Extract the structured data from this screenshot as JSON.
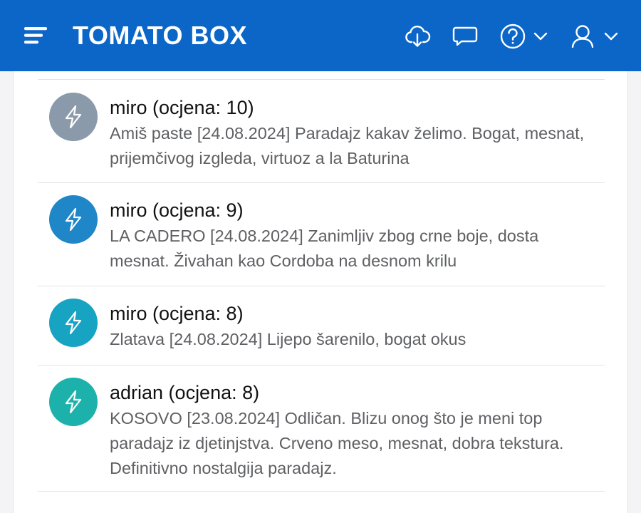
{
  "header": {
    "title": "TOMATO BOX",
    "background": "#0b66c8",
    "icons": [
      "menu-icon",
      "cloud-download-icon",
      "chat-bubble-icon",
      "help-icon",
      "chevron-down-icon",
      "user-icon",
      "chevron-down-icon"
    ]
  },
  "reviews": [
    {
      "title": "miro (ocjena: 10)",
      "body": "Amiš paste [24.08.2024] Paradajz kakav želimo. Bogat, mesnat, prijemčivog izgleda, virtuoz a la Baturina",
      "avatar_color": "#8a9aab",
      "icon": "lightning-icon"
    },
    {
      "title": "miro (ocjena: 9)",
      "body": "LA CADERO [24.08.2024] Zanimljiv zbog crne boje, dosta mesnat. Živahan kao Cordoba na desnom krilu",
      "avatar_color": "#1f86c8",
      "icon": "lightning-icon"
    },
    {
      "title": "miro (ocjena: 8)",
      "body": "Zlatava [24.08.2024] Lijepo šarenilo, bogat okus",
      "avatar_color": "#17a3c2",
      "icon": "lightning-icon"
    },
    {
      "title": "adrian (ocjena: 8)",
      "body": "KOSOVO [23.08.2024] Odličan. Blizu onog što je meni top paradajz iz djetinjstva. Crveno meso, mesnat, dobra tekstura. Definitivno nostalgija paradajz.",
      "avatar_color": "#1cb2ab",
      "icon": "lightning-icon"
    }
  ]
}
